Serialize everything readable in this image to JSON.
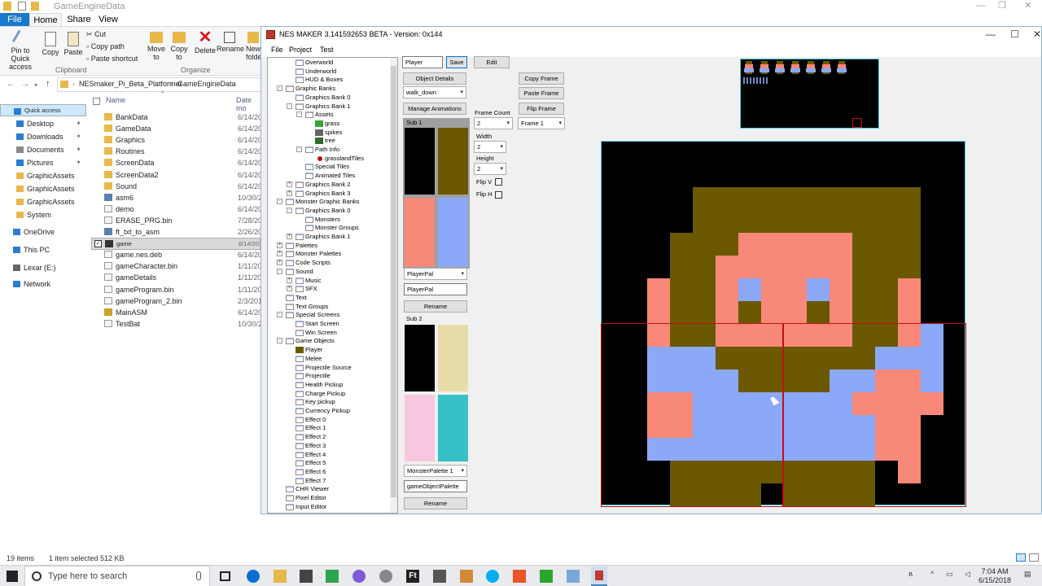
{
  "explorer": {
    "title": "GameEngineData",
    "tabs": [
      "File",
      "Home",
      "Share",
      "View"
    ],
    "window_controls": [
      "—",
      "❐",
      "✕"
    ],
    "ribbon": {
      "pin": "Pin to Quick access",
      "copy": "Copy",
      "paste": "Paste",
      "cut": "Cut",
      "copy_path": "Copy path",
      "paste_shortcut": "Paste shortcut",
      "move_to": "Move to",
      "copy_to": "Copy to",
      "delete": "Delete",
      "rename": "Rename",
      "new_folder": "New folder",
      "group_clipboard": "Clipboard",
      "group_organize": "Organize"
    },
    "address": {
      "part1": "NESmaker_Pi_Beta_Platformer",
      "sep": "›",
      "part2": "GameEngineData"
    },
    "nav_pane": [
      {
        "label": "Quick access",
        "color": "#2b7cd3"
      },
      {
        "label": "Desktop",
        "color": "#2b7cd3"
      },
      {
        "label": "Downloads",
        "color": "#2b7cd3"
      },
      {
        "label": "Documents",
        "color": "#8a8a8a"
      },
      {
        "label": "Pictures",
        "color": "#2b7cd3"
      },
      {
        "label": "GraphicAssets",
        "color": "#e8b84a"
      },
      {
        "label": "GraphicAssets",
        "color": "#e8b84a"
      },
      {
        "label": "GraphicAssets",
        "color": "#e8b84a"
      },
      {
        "label": "System",
        "color": "#e8b84a"
      },
      {
        "label": "OneDrive",
        "color": "#2b7cd3"
      },
      {
        "label": "This PC",
        "color": "#2b7cd3"
      },
      {
        "label": "Lexar (E:)",
        "color": "#666666"
      },
      {
        "label": "Network",
        "color": "#2b7cd3"
      }
    ],
    "columns": {
      "name": "Name",
      "date": "Date mo"
    },
    "files": [
      {
        "name": "BankData",
        "date": "6/14/20",
        "icon": "folder"
      },
      {
        "name": "GameData",
        "date": "6/14/20",
        "icon": "folder"
      },
      {
        "name": "Graphics",
        "date": "6/14/20",
        "icon": "folder"
      },
      {
        "name": "Routines",
        "date": "6/14/20",
        "icon": "folder"
      },
      {
        "name": "ScreenData",
        "date": "6/14/20",
        "icon": "folder"
      },
      {
        "name": "ScreenData2",
        "date": "6/14/20",
        "icon": "folder"
      },
      {
        "name": "Sound",
        "date": "6/14/20",
        "icon": "folder"
      },
      {
        "name": "asm6",
        "date": "10/30/20",
        "icon": "exe"
      },
      {
        "name": "demo",
        "date": "6/14/20",
        "icon": "file"
      },
      {
        "name": "ERASE_PRG.bin",
        "date": "7/28/20",
        "icon": "file"
      },
      {
        "name": "ft_txt_to_asm",
        "date": "2/26/20",
        "icon": "exe"
      },
      {
        "name": "game",
        "date": "6/14/20",
        "icon": "game"
      },
      {
        "name": "game.nes.deb",
        "date": "6/14/20",
        "icon": "file"
      },
      {
        "name": "gameCharacter.bin",
        "date": "1/11/20",
        "icon": "file"
      },
      {
        "name": "gameDetails",
        "date": "1/11/20",
        "icon": "file"
      },
      {
        "name": "gameProgram.bin",
        "date": "1/11/20",
        "icon": "file"
      },
      {
        "name": "gameProgram_2.bin",
        "date": "2/3/201",
        "icon": "file"
      },
      {
        "name": "MainASM",
        "date": "6/14/20",
        "icon": "asm"
      },
      {
        "name": "TestBat",
        "date": "10/30/20",
        "icon": "file"
      }
    ],
    "status": {
      "items": "19 items",
      "selected": "1 item selected  512 KB"
    }
  },
  "nes": {
    "title": "NES MAKER 3.141592653 BETA  -  Version: 0x144",
    "menu": [
      "File",
      "Project",
      "Test"
    ],
    "tree": [
      {
        "label": "Overworld",
        "level": 1
      },
      {
        "label": "Underworld",
        "level": 1
      },
      {
        "label": "HUD & Boxes",
        "level": 1
      },
      {
        "label": "Graphic Banks",
        "level": 0,
        "exp": "-"
      },
      {
        "label": "Graphics Bank 0",
        "level": 1
      },
      {
        "label": "Graphics Bank 1",
        "level": 1,
        "exp": "-"
      },
      {
        "label": "Assets",
        "level": 2,
        "exp": "-"
      },
      {
        "label": "grass",
        "level": 3,
        "icon": "grass"
      },
      {
        "label": "spikes",
        "level": 3,
        "icon": "spikes"
      },
      {
        "label": "tree",
        "level": 3,
        "icon": "tree"
      },
      {
        "label": "Path Info",
        "level": 2,
        "exp": "-"
      },
      {
        "label": "grasslandTiles",
        "level": 3,
        "icon": "dot"
      },
      {
        "label": "Special Tiles",
        "level": 2
      },
      {
        "label": "Animated Tiles",
        "level": 2
      },
      {
        "label": "Graphics Bank 2",
        "level": 1,
        "exp": "+"
      },
      {
        "label": "Graphics Bank 3",
        "level": 1,
        "exp": "+"
      },
      {
        "label": "Monster Graphic Banks",
        "level": 0,
        "exp": "-"
      },
      {
        "label": "Graphics Bank 0",
        "level": 1,
        "exp": "-"
      },
      {
        "label": "Monsters",
        "level": 2
      },
      {
        "label": "Monster Groups",
        "level": 2
      },
      {
        "label": "Graphics Bank 1",
        "level": 1,
        "exp": "+"
      },
      {
        "label": "Palettes",
        "level": 0,
        "exp": "+"
      },
      {
        "label": "Monster Palettes",
        "level": 0,
        "exp": "+"
      },
      {
        "label": "Code Scripts",
        "level": 0,
        "exp": "+"
      },
      {
        "label": "Sound",
        "level": 0,
        "exp": "-"
      },
      {
        "label": "Music",
        "level": 1,
        "exp": "+"
      },
      {
        "label": "SFX",
        "level": 1,
        "exp": "+"
      },
      {
        "label": "Text",
        "level": 0
      },
      {
        "label": "Text Groups",
        "level": 0
      },
      {
        "label": "Special Screens",
        "level": 0,
        "exp": "-"
      },
      {
        "label": "Start Screen",
        "level": 1
      },
      {
        "label": "Win Screen",
        "level": 1
      },
      {
        "label": "Game Objects",
        "level": 0,
        "exp": "-"
      },
      {
        "label": "Player",
        "level": 1,
        "icon": "player"
      },
      {
        "label": "Melee",
        "level": 1
      },
      {
        "label": "Projectile Source",
        "level": 1
      },
      {
        "label": "Projectile",
        "level": 1
      },
      {
        "label": "Health Pickup",
        "level": 1
      },
      {
        "label": "Charge Pickup",
        "level": 1
      },
      {
        "label": "Key pickup",
        "level": 1
      },
      {
        "label": "Currency Pickup",
        "level": 1
      },
      {
        "label": "Effect 0",
        "level": 1
      },
      {
        "label": "Effect 1",
        "level": 1
      },
      {
        "label": "Effect 2",
        "level": 1
      },
      {
        "label": "Effect 3",
        "level": 1
      },
      {
        "label": "Effect 4",
        "level": 1
      },
      {
        "label": "Effect 5",
        "level": 1
      },
      {
        "label": "Effect 6",
        "level": 1
      },
      {
        "label": "Effect 7",
        "level": 1
      },
      {
        "label": "CHR Viewer",
        "level": 0
      },
      {
        "label": "Pixel Editor",
        "level": 0
      },
      {
        "label": "Input Editor",
        "level": 0
      }
    ],
    "object_name": "Player",
    "save_label": "Save",
    "edit_label": "Edit",
    "object_details_label": "Object Details",
    "animation_select": "walk_down",
    "manage_animations_label": "Manage Animations",
    "copy_frame_label": "Copy Frame",
    "paste_frame_label": "Paste Frame",
    "flip_frame_label": "Flip Frame",
    "frame_count_label": "Frame Count",
    "frame_count_value": "2",
    "frame_select": "Frame 1",
    "width_label": "Width",
    "width_value": "2",
    "height_label": "Height",
    "height_value": "2",
    "flip_v_label": "Flip V",
    "flip_h_label": "Flip H",
    "sub1_label": "Sub 1",
    "sub1_colors": [
      "#000000",
      "#6b5800",
      "#f88878",
      "#8ca8f8"
    ],
    "palette1_select": "PlayerPal",
    "palette1_name": "PlayerPal",
    "rename1_label": "Rename",
    "sub2_label": "Sub 2",
    "sub2_colors": [
      "#000000",
      "#e8dca8",
      "#f8c8e0",
      "#38c0c8"
    ],
    "palette2_select": "MonsterPalette 1",
    "palette2_name": "gameObjectPalette",
    "rename2_label": "Rename",
    "window_controls": [
      "—",
      "☐",
      "✕"
    ]
  },
  "taskbar": {
    "search_placeholder": "Type here to search",
    "time": "7:04 AM",
    "date": "6/15/2018"
  },
  "colors": {
    "brown": "#6b5800",
    "skin": "#f88878",
    "blue": "#8ca8f8",
    "black": "#000000",
    "grid_red": "#c0101a",
    "cyan_border": "#4fd0e0"
  }
}
